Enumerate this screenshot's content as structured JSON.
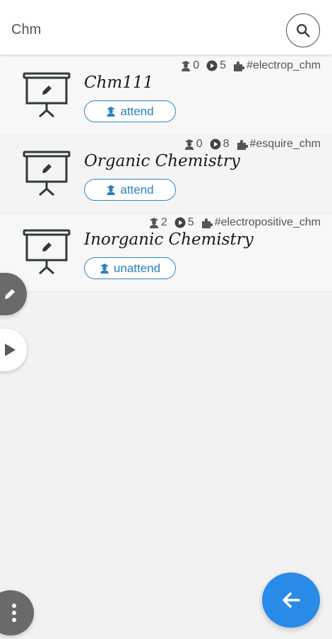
{
  "search": {
    "value": "Chm",
    "icon": "search-icon"
  },
  "courses": [
    {
      "title": "Chm111",
      "students": "0",
      "videos": "5",
      "tag": "#electrop_chm",
      "button_label": "attend"
    },
    {
      "title": "Organic Chemistry",
      "students": "0",
      "videos": "8",
      "tag": "#esquire_chm",
      "button_label": "attend"
    },
    {
      "title": "Inorganic Chemistry",
      "students": "2",
      "videos": "5",
      "tag": "#electropositive_chm",
      "button_label": "unattend"
    }
  ],
  "fabs": {
    "edit_icon": "pencil-icon",
    "play_icon": "play-icon",
    "more_icon": "more-vertical-icon",
    "back_icon": "arrow-left-icon"
  },
  "colors": {
    "accent": "#2a8ae8",
    "button_border": "#2a86c9",
    "fab_gray": "#6a6a6a",
    "icon_dark": "#2f3a3a"
  }
}
